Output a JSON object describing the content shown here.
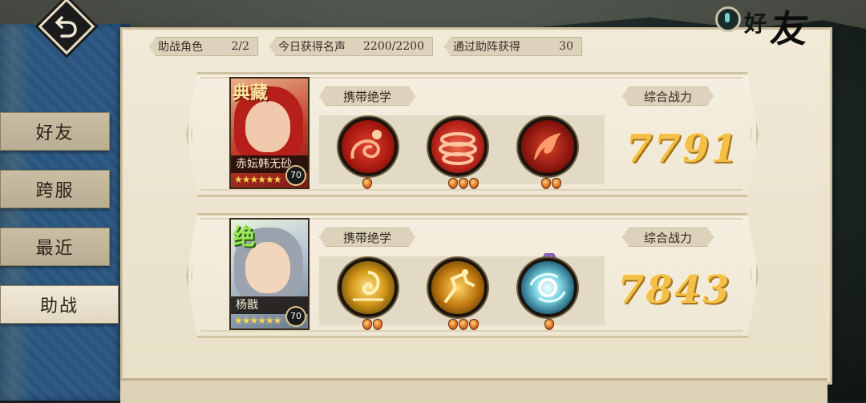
{
  "header": {
    "title_left": "好",
    "title_right": "友"
  },
  "stats": {
    "assist_label": "助战角色",
    "assist_value": "2/2",
    "fame_label": "今日获得名声",
    "fame_value": "2200/2200",
    "gain_label": "通过助阵获得",
    "gain_value": "30"
  },
  "nav": {
    "items": [
      {
        "label": "好友"
      },
      {
        "label": "跨服"
      },
      {
        "label": "最近"
      },
      {
        "label": "助战"
      }
    ]
  },
  "cards": [
    {
      "name": "赤妘韩无砂",
      "level": "70",
      "stars": "★★★★★★",
      "rank_mark": "典藏",
      "skills_label": "携带绝学",
      "power_label": "综合战力",
      "power": "7791",
      "accent": "#c4261a"
    },
    {
      "name": "杨戬",
      "level": "70",
      "stars": "★★★★★★",
      "rank_mark": "绝",
      "skills_label": "携带绝学",
      "power_label": "综合战力",
      "power": "7843",
      "passive_badge": "被",
      "accent": "#d4a21e"
    }
  ]
}
